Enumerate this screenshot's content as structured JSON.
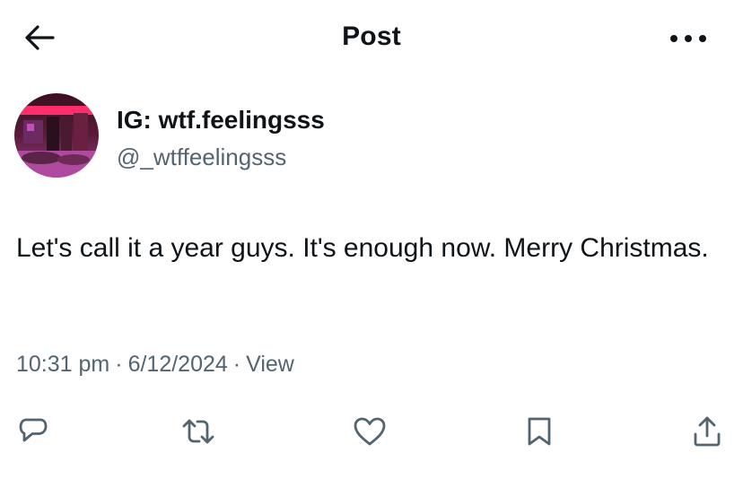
{
  "header": {
    "title": "Post",
    "back_icon": "arrow-left-icon",
    "more_icon": "more-horizontal-icon"
  },
  "author": {
    "display_name": "IG: wtf.feelingsss",
    "handle": "@_wtffeelingsss"
  },
  "post": {
    "text": "Let's call it a year guys. It's enough now. Merry Christmas."
  },
  "meta": {
    "time": "10:31 pm",
    "date": "6/12/2024",
    "separator": "·",
    "views_label": "View"
  },
  "actions": [
    {
      "icon": "reply-icon"
    },
    {
      "icon": "repost-icon"
    },
    {
      "icon": "like-icon"
    },
    {
      "icon": "bookmark-icon"
    },
    {
      "icon": "share-icon"
    }
  ],
  "colors": {
    "text": "#0f1419",
    "secondary": "#536471",
    "background": "#ffffff"
  }
}
